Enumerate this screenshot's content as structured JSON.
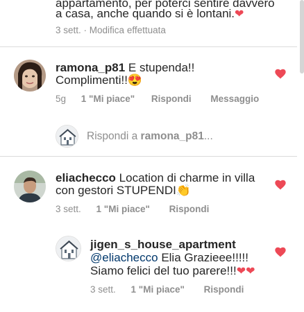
{
  "top_comment": {
    "line1": "appartamento, per poterci sentire davvero",
    "line2": "a casa, anche quando si è lontani.",
    "emoji": "❤",
    "time": "3 sett.",
    "edited": "Modifica effettuata"
  },
  "comments": [
    {
      "username": "ramona_p81",
      "text_line1": " E stupenda!!",
      "text_line2": "Complimenti!!",
      "emoji": "😍",
      "time": "5g",
      "likes": "1 \"Mi piace\"",
      "reply_label": "Rispondi",
      "message_label": "Messaggio"
    },
    {
      "username": "eliachecco",
      "text_line1": " Location di charme in villa",
      "text_line2": "con gestori STUPENDI",
      "emoji": "👏",
      "time": "3 sett.",
      "likes": "1 \"Mi piace\"",
      "reply_label": "Rispondi"
    }
  ],
  "reply_input": {
    "label_prefix": "Rispondi a ",
    "label_user": "ramona_p81",
    "label_suffix": "..."
  },
  "nested_reply": {
    "username": "jigen_s_house_apartment",
    "mention": "@eliachecco",
    "text_line1": " Elia Grazieee!!!!!",
    "text_line2": "Siamo felici del tuo parere!!!",
    "emoji": "❤❤",
    "time": "3 sett.",
    "likes": "1 \"Mi piace\"",
    "reply_label": "Rispondi"
  },
  "colors": {
    "like_heart": "#ed4956",
    "meta_text": "#8e8e8e",
    "mention": "#00376b"
  }
}
